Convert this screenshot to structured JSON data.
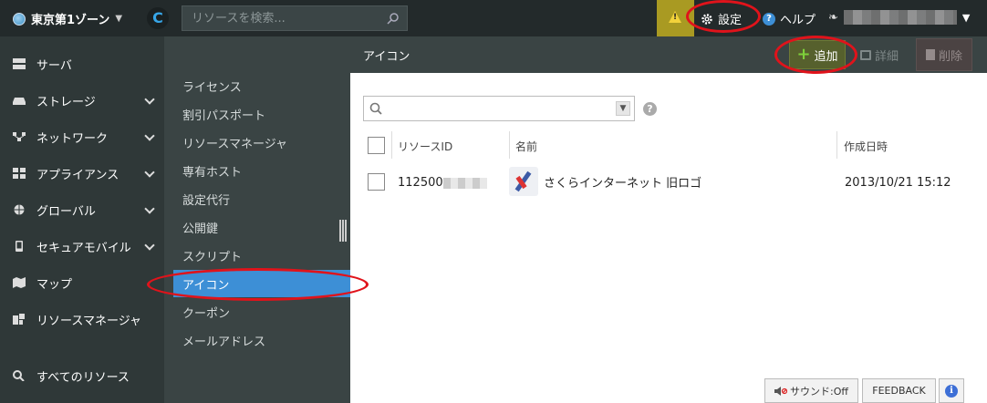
{
  "topbar": {
    "zone_label": "東京第1ゾーン",
    "search_placeholder": "リソースを検索...",
    "settings_label": "設定",
    "help_label": "ヘルプ"
  },
  "sidebar": {
    "items": [
      {
        "label": "サーバ",
        "icon": "server-icon",
        "expandable": false
      },
      {
        "label": "ストレージ",
        "icon": "storage-icon",
        "expandable": true
      },
      {
        "label": "ネットワーク",
        "icon": "network-icon",
        "expandable": true
      },
      {
        "label": "アプライアンス",
        "icon": "appliance-icon",
        "expandable": true
      },
      {
        "label": "グローバル",
        "icon": "globe-icon",
        "expandable": true
      },
      {
        "label": "セキュアモバイル",
        "icon": "mobile-icon",
        "expandable": true
      },
      {
        "label": "マップ",
        "icon": "map-icon",
        "expandable": false
      },
      {
        "label": "リソースマネージャ",
        "icon": "resource-manager-icon",
        "expandable": false
      }
    ],
    "all_resources_label": "すべてのリソース"
  },
  "subnav": {
    "items": [
      {
        "label": "ライセンス"
      },
      {
        "label": "割引パスポート"
      },
      {
        "label": "リソースマネージャ"
      },
      {
        "label": "専有ホスト"
      },
      {
        "label": "設定代行"
      },
      {
        "label": "公開鍵"
      },
      {
        "label": "スクリプト"
      },
      {
        "label": "アイコン"
      },
      {
        "label": "クーポン"
      },
      {
        "label": "メールアドレス"
      }
    ],
    "active_index": 7
  },
  "content": {
    "title": "アイコン",
    "add_label": "追加",
    "detail_label": "詳細",
    "delete_label": "削除",
    "columns": [
      "リソースID",
      "名前",
      "作成日時"
    ],
    "rows": [
      {
        "resource_id": "112500",
        "name": "さくらインターネット 旧ロゴ",
        "created": "2013/10/21 15:12"
      }
    ]
  },
  "footer": {
    "sound_label": "サウンド:Off",
    "feedback_label": "FEEDBACK"
  },
  "colors": {
    "accent": "#3d8fd6",
    "warning": "#a99a22",
    "highlight_ring": "#e0131b",
    "add_button": "#56602d"
  }
}
